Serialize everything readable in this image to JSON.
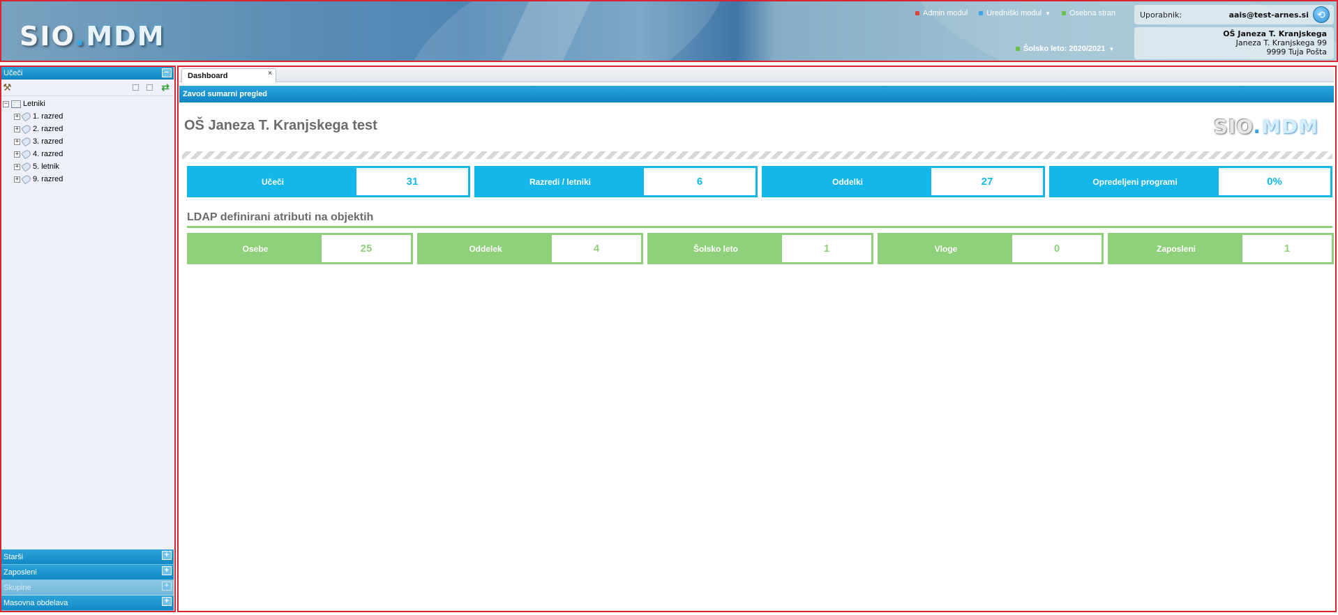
{
  "header": {
    "logo": {
      "part1": "SIO",
      "dot": ".",
      "part2": "MDM"
    },
    "nav": [
      {
        "label": "Admin modul",
        "bullet_color": "#e0453d"
      },
      {
        "label": "Uredniški modul",
        "bullet_color": "#3aa6e6"
      },
      {
        "label": "Osebna stran",
        "bullet_color": "#6cc04a"
      }
    ],
    "school_year": "Šolsko leto: 2020/2021",
    "user_label": "Uporabnik:",
    "user_email": "aais@test-arnes.si",
    "school": {
      "name": "OŠ Janeza T. Kranjskega",
      "street": "Janeza T. Kranjskega 99",
      "city": "9999 Tuja Pošta"
    }
  },
  "sidebar": {
    "active_section": "Učeči",
    "tree_root": "Letniki",
    "tree_items": [
      "1. razred",
      "2. razred",
      "3. razred",
      "4. razred",
      "5. letnik",
      "9. razred"
    ],
    "sections": [
      {
        "label": "Starši",
        "disabled": false
      },
      {
        "label": "Zaposleni",
        "disabled": false
      },
      {
        "label": "Skupine",
        "disabled": true
      },
      {
        "label": "Masovna obdelava",
        "disabled": false
      }
    ]
  },
  "main": {
    "tab_label": "Dashboard",
    "panel_title": "Zavod sumarni pregled",
    "school_title": "OŠ Janeza T. Kranjskega test",
    "stats_primary": [
      {
        "label": "Učeči",
        "value": "31"
      },
      {
        "label": "Razredi / letniki",
        "value": "6"
      },
      {
        "label": "Oddelki",
        "value": "27"
      },
      {
        "label": "Opredeljeni programi",
        "value": "0%"
      }
    ],
    "ldap_title": "LDAP definirani atributi na objektih",
    "stats_ldap": [
      {
        "label": "Osebe",
        "value": "25"
      },
      {
        "label": "Oddelek",
        "value": "4"
      },
      {
        "label": "Šolsko leto",
        "value": "1"
      },
      {
        "label": "Vloge",
        "value": "0"
      },
      {
        "label": "Zaposleni",
        "value": "1"
      }
    ]
  }
}
